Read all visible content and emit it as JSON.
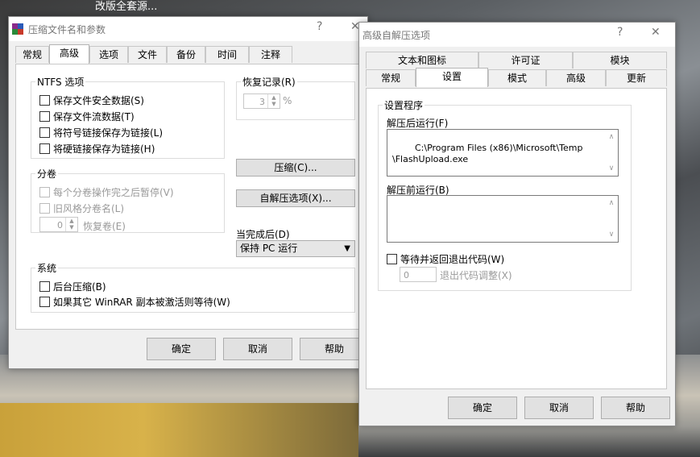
{
  "background": {
    "caption": "改版全套源..."
  },
  "win1": {
    "title": "压缩文件名和参数",
    "help_btn": "?",
    "close_btn": "✕",
    "tabs": [
      "常规",
      "高级",
      "选项",
      "文件",
      "备份",
      "时间",
      "注释"
    ],
    "active_tab": "高级",
    "ntfs": {
      "label": "NTFS 选项",
      "items": [
        {
          "label": "保存文件安全数据(S)",
          "checked": false
        },
        {
          "label": "保存文件流数据(T)",
          "checked": false
        },
        {
          "label": "将符号链接保存为链接(L)",
          "checked": false
        },
        {
          "label": "将硬链接保存为链接(H)",
          "checked": false
        }
      ]
    },
    "recovery": {
      "label": "恢复记录(R)",
      "value": "3",
      "unit": "%"
    },
    "compress_btn": "压缩(C)...",
    "sfx_btn": "自解压选项(X)...",
    "volumes": {
      "label": "分卷",
      "pause": "每个分卷操作完之后暂停(V)",
      "old_style": "旧风格分卷名(L)",
      "recovery_value": "0",
      "recovery_label": "恢复卷(E)"
    },
    "on_complete": {
      "label": "当完成后(D)",
      "selected": "保持 PC 运行"
    },
    "system": {
      "label": "系统",
      "background": "后台压缩(B)",
      "wait": "如果其它 WinRAR 副本被激活则等待(W)"
    },
    "buttons": {
      "ok": "确定",
      "cancel": "取消",
      "help": "帮助"
    }
  },
  "win2": {
    "title": "高级自解压选项",
    "help_btn": "?",
    "close_btn": "✕",
    "tabs_row1": [
      "文本和图标",
      "许可证",
      "模块"
    ],
    "tabs_row2": [
      "常规",
      "设置",
      "模式",
      "高级",
      "更新"
    ],
    "active_tab": "设置",
    "setup": {
      "label": "设置程序",
      "run_after_label": "解压后运行(F)",
      "run_after_value": "C:\\Program Files (x86)\\Microsoft\\Temp\n\\FlashUpload.exe",
      "run_before_label": "解压前运行(B)",
      "run_before_value": "",
      "wait_label": "等待并返回退出代码(W)",
      "exit_code_value": "0",
      "exit_code_label": "退出代码调整(X)"
    },
    "buttons": {
      "ok": "确定",
      "cancel": "取消",
      "help": "帮助"
    }
  },
  "colors": {
    "accent": "#0078d7",
    "button_face": "#e1e1e1",
    "panel": "#f0f0f0"
  }
}
